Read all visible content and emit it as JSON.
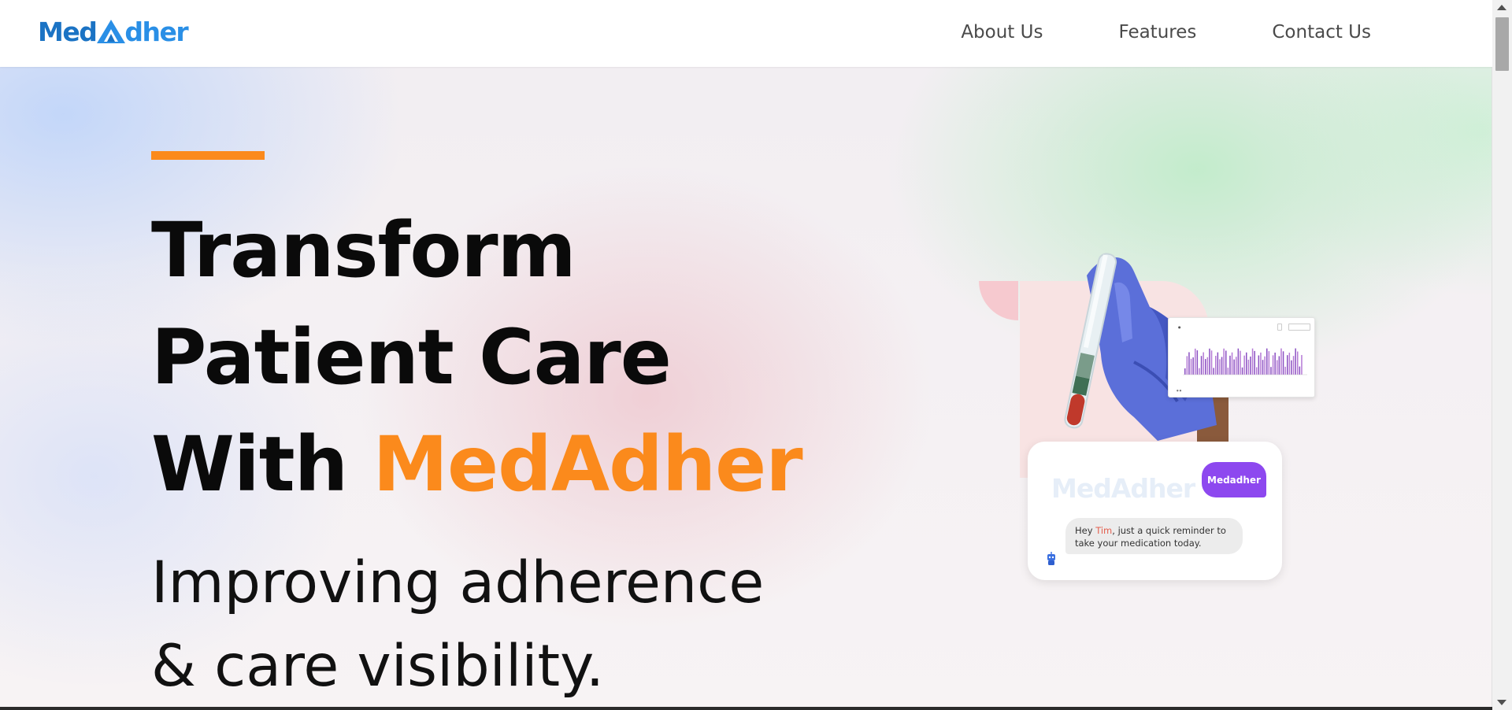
{
  "header": {
    "logo_part1": "Med",
    "logo_part2": "dher",
    "nav": [
      "About Us",
      "Features",
      "Contact Us"
    ]
  },
  "hero": {
    "headline_line1": "Transform",
    "headline_line2": "Patient Care",
    "headline_line3_prefix": "With ",
    "headline_brand": "MedAdher",
    "subhead_line1": "Improving adherence",
    "subhead_line2": "& care visibility."
  },
  "chat": {
    "faint_logo": "MedAdher",
    "sender_label": "Medadher",
    "message_prefix": "Hey ",
    "message_name": "Tim",
    "message_suffix": ", just a quick reminder to take your medication today."
  },
  "colors": {
    "brand_orange": "#fb8a1c",
    "brand_blue": "#1b73c4",
    "chat_purple": "#8d48ef",
    "name_red": "#e4604f"
  },
  "icons": [
    "logo-mountain-icon",
    "robot-icon",
    "scroll-up-icon",
    "scroll-down-icon"
  ]
}
